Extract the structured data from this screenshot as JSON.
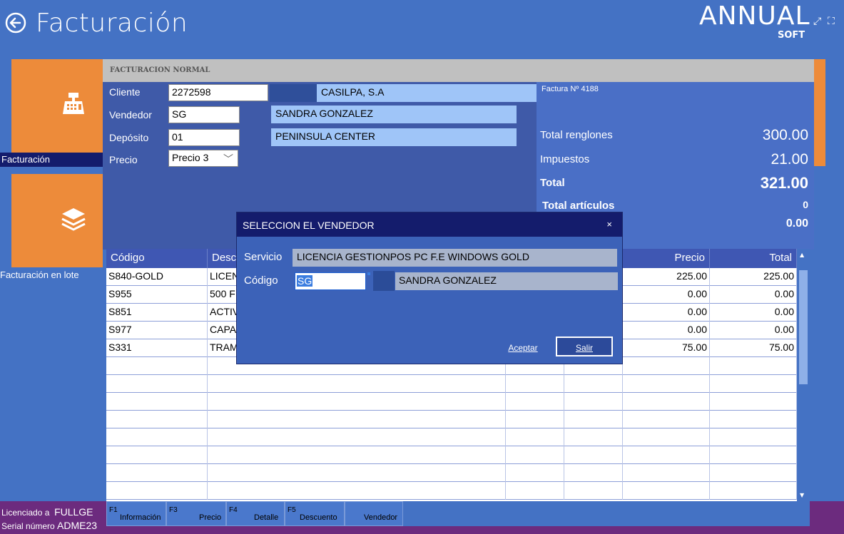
{
  "header": {
    "title": "Facturación",
    "logo": "ANNUAL",
    "logo_sub": "SOFT"
  },
  "sidebar": {
    "items": [
      {
        "label": "Facturación",
        "icon": "cash-register-icon"
      },
      {
        "label": "Facturación en lote",
        "icon": "layers-icon"
      }
    ]
  },
  "invoice": {
    "section_title": "FACTURACION NORMAL",
    "cliente_label": "Cliente",
    "cliente_code": "2272598",
    "cliente_name": "CASILPA, S.A",
    "vendedor_label": "Vendedor",
    "vendedor_code": "SG",
    "vendedor_name": "SANDRA GONZALEZ",
    "deposito_label": "Depósito",
    "deposito_code": "01",
    "deposito_name": "PENINSULA CENTER",
    "precio_label": "Precio",
    "precio_value": "Precio 3",
    "factura_label": "Factura Nº  4188"
  },
  "summary": {
    "renglones_label": "Total renglones",
    "renglones_value": "300.00",
    "impuestos_label": "Impuestos",
    "impuestos_value": "21.00",
    "total_label": "Total",
    "total_value": "321.00",
    "articulos_label": "Total artículos",
    "articulos_value": "0",
    "extra_value": "0.00"
  },
  "table": {
    "headers": {
      "codigo": "Código",
      "descripcion": "Descr",
      "precio": "Precio",
      "total": "Total"
    },
    "rows": [
      {
        "codigo": "S840-GOLD",
        "desc": "LICEN",
        "precio": "225.00",
        "total": "225.00"
      },
      {
        "codigo": "S955",
        "desc": "500 F",
        "precio": "0.00",
        "total": "0.00"
      },
      {
        "codigo": "S851",
        "desc": "ACTIV",
        "precio": "0.00",
        "total": "0.00"
      },
      {
        "codigo": "S977",
        "desc": "CAPA",
        "precio": "0.00",
        "total": "0.00"
      },
      {
        "codigo": "S331",
        "desc": "TRAM",
        "precio": "75.00",
        "total": "75.00"
      }
    ]
  },
  "fkeys": [
    {
      "key": "F1",
      "label": "Información"
    },
    {
      "key": "F3",
      "label": "Precio"
    },
    {
      "key": "F4",
      "label": "Detalle"
    },
    {
      "key": "F5",
      "label": "Descuento"
    },
    {
      "key": "",
      "label": "Vendedor"
    }
  ],
  "license": {
    "licenciado_label": "Licenciado a",
    "licenciado_value": "FULLGE",
    "serial_label": "Serial número",
    "serial_value": "ADME23"
  },
  "dialog": {
    "title": "SELECCION EL VENDEDOR",
    "close": "×",
    "servicio_label": "Servicio",
    "servicio_value": "LICENCIA GESTIONPOS PC F.E WINDOWS GOLD",
    "codigo_label": "Código",
    "codigo_value": "SG",
    "vendedor_name": "SANDRA GONZALEZ",
    "aceptar": "Aceptar",
    "salir": "Salir"
  }
}
